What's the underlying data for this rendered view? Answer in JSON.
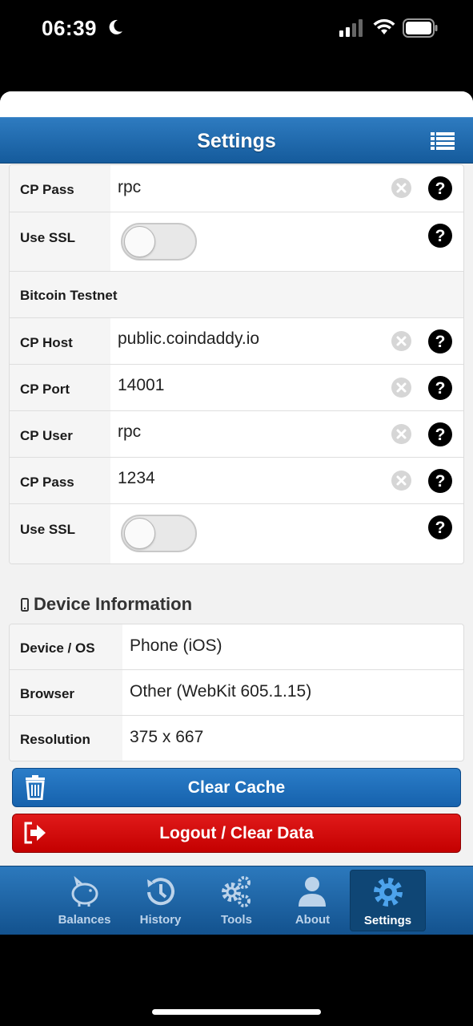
{
  "status_bar": {
    "time": "06:39"
  },
  "header": {
    "title": "Settings"
  },
  "mainnet_tail": [
    {
      "label": "CP Pass",
      "value": "rpc",
      "type": "text"
    },
    {
      "label": "Use SSL",
      "type": "toggle",
      "on": false
    }
  ],
  "testnet": {
    "title": "Bitcoin Testnet",
    "rows": [
      {
        "label": "CP Host",
        "value": "public.coindaddy.io"
      },
      {
        "label": "CP Port",
        "value": "14001"
      },
      {
        "label": "CP User",
        "value": "rpc"
      },
      {
        "label": "CP Pass",
        "value": "1234"
      },
      {
        "label": "Use SSL",
        "on": false
      }
    ]
  },
  "device": {
    "heading": "Device Information",
    "rows": [
      {
        "label": "Device / OS",
        "value": "Phone (iOS)"
      },
      {
        "label": "Browser",
        "value": "Other (WebKit 605.1.15)"
      },
      {
        "label": "Resolution",
        "value": "375 x 667"
      }
    ]
  },
  "buttons": {
    "clear_cache": "Clear Cache",
    "logout": "Logout / Clear Data"
  },
  "tabs": [
    {
      "label": "Balances",
      "icon": "piggy-bank-icon"
    },
    {
      "label": "History",
      "icon": "history-icon"
    },
    {
      "label": "Tools",
      "icon": "gears-icon"
    },
    {
      "label": "About",
      "icon": "user-icon"
    },
    {
      "label": "Settings",
      "icon": "gear-icon",
      "active": true
    }
  ],
  "colors": {
    "header_blue": "#1f6db3",
    "logout_red": "#d10f0f",
    "active_tab": "#0f4675"
  }
}
